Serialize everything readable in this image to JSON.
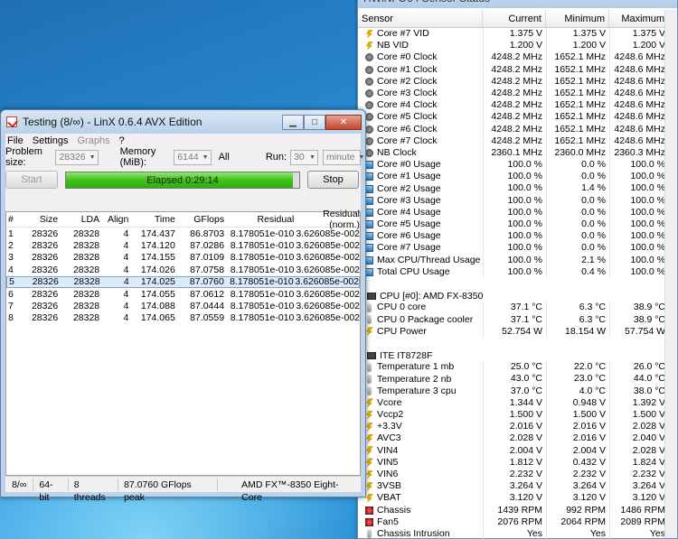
{
  "hwinfo": {
    "title": "HWiNFO64 Sensor Status",
    "columns": [
      "Sensor",
      "Current",
      "Minimum",
      "Maximum"
    ],
    "groups": [
      {
        "header": "",
        "rows": [
          {
            "icon": "volt",
            "name": "Core #7 VID",
            "cur": "1.375 V",
            "min": "1.375 V",
            "max": "1.375 V"
          },
          {
            "icon": "volt",
            "name": "NB VID",
            "cur": "1.200 V",
            "min": "1.200 V",
            "max": "1.200 V"
          },
          {
            "icon": "clock",
            "name": "Core #0 Clock",
            "cur": "4248.2 MHz",
            "min": "1652.1 MHz",
            "max": "4248.6 MHz"
          },
          {
            "icon": "clock",
            "name": "Core #1 Clock",
            "cur": "4248.2 MHz",
            "min": "1652.1 MHz",
            "max": "4248.6 MHz"
          },
          {
            "icon": "clock",
            "name": "Core #2 Clock",
            "cur": "4248.2 MHz",
            "min": "1652.1 MHz",
            "max": "4248.6 MHz"
          },
          {
            "icon": "clock",
            "name": "Core #3 Clock",
            "cur": "4248.2 MHz",
            "min": "1652.1 MHz",
            "max": "4248.6 MHz"
          },
          {
            "icon": "clock",
            "name": "Core #4 Clock",
            "cur": "4248.2 MHz",
            "min": "1652.1 MHz",
            "max": "4248.6 MHz"
          },
          {
            "icon": "clock",
            "name": "Core #5 Clock",
            "cur": "4248.2 MHz",
            "min": "1652.1 MHz",
            "max": "4248.6 MHz"
          },
          {
            "icon": "clock",
            "name": "Core #6 Clock",
            "cur": "4248.2 MHz",
            "min": "1652.1 MHz",
            "max": "4248.6 MHz"
          },
          {
            "icon": "clock",
            "name": "Core #7 Clock",
            "cur": "4248.2 MHz",
            "min": "1652.1 MHz",
            "max": "4248.6 MHz"
          },
          {
            "icon": "clock",
            "name": "NB Clock",
            "cur": "2360.1 MHz",
            "min": "2360.0 MHz",
            "max": "2360.3 MHz"
          },
          {
            "icon": "usage",
            "name": "Core #0 Usage",
            "cur": "100.0 %",
            "min": "0.0 %",
            "max": "100.0 %"
          },
          {
            "icon": "usage",
            "name": "Core #1 Usage",
            "cur": "100.0 %",
            "min": "0.0 %",
            "max": "100.0 %"
          },
          {
            "icon": "usage",
            "name": "Core #2 Usage",
            "cur": "100.0 %",
            "min": "1.4 %",
            "max": "100.0 %"
          },
          {
            "icon": "usage",
            "name": "Core #3 Usage",
            "cur": "100.0 %",
            "min": "0.0 %",
            "max": "100.0 %"
          },
          {
            "icon": "usage",
            "name": "Core #4 Usage",
            "cur": "100.0 %",
            "min": "0.0 %",
            "max": "100.0 %"
          },
          {
            "icon": "usage",
            "name": "Core #5 Usage",
            "cur": "100.0 %",
            "min": "0.0 %",
            "max": "100.0 %"
          },
          {
            "icon": "usage",
            "name": "Core #6 Usage",
            "cur": "100.0 %",
            "min": "0.0 %",
            "max": "100.0 %"
          },
          {
            "icon": "usage",
            "name": "Core #7 Usage",
            "cur": "100.0 %",
            "min": "0.0 %",
            "max": "100.0 %"
          },
          {
            "icon": "usage",
            "name": "Max CPU/Thread Usage",
            "cur": "100.0 %",
            "min": "2.1 %",
            "max": "100.0 %"
          },
          {
            "icon": "usage",
            "name": "Total CPU Usage",
            "cur": "100.0 %",
            "min": "0.4 %",
            "max": "100.0 %"
          }
        ]
      },
      {
        "header": "CPU [#0]: AMD FX-8350",
        "rows": [
          {
            "icon": "temp",
            "name": "CPU 0 core",
            "cur": "37.1 °C",
            "min": "6.3 °C",
            "max": "38.9 °C"
          },
          {
            "icon": "temp",
            "name": "CPU 0 Package cooler",
            "cur": "37.1 °C",
            "min": "6.3 °C",
            "max": "38.9 °C"
          },
          {
            "icon": "power",
            "name": "CPU Power",
            "cur": "52.754 W",
            "min": "18.154 W",
            "max": "57.754 W"
          }
        ]
      },
      {
        "header": "ITE IT8728F",
        "rows": [
          {
            "icon": "temp",
            "name": "Temperature 1 mb",
            "cur": "25.0 °C",
            "min": "22.0 °C",
            "max": "26.0 °C"
          },
          {
            "icon": "temp",
            "name": "Temperature 2 nb",
            "cur": "43.0 °C",
            "min": "23.0 °C",
            "max": "44.0 °C"
          },
          {
            "icon": "temp",
            "name": "Temperature 3 cpu",
            "cur": "37.0 °C",
            "min": "4.0 °C",
            "max": "38.0 °C"
          },
          {
            "icon": "volt",
            "name": "Vcore",
            "cur": "1.344 V",
            "min": "0.948 V",
            "max": "1.392 V"
          },
          {
            "icon": "volt",
            "name": "Vccp2",
            "cur": "1.500 V",
            "min": "1.500 V",
            "max": "1.500 V"
          },
          {
            "icon": "volt",
            "name": "+3.3V",
            "cur": "2.016 V",
            "min": "2.016 V",
            "max": "2.028 V"
          },
          {
            "icon": "volt",
            "name": "AVC3",
            "cur": "2.028 V",
            "min": "2.016 V",
            "max": "2.040 V"
          },
          {
            "icon": "volt",
            "name": "VIN4",
            "cur": "2.004 V",
            "min": "2.004 V",
            "max": "2.028 V"
          },
          {
            "icon": "volt",
            "name": "VIN5",
            "cur": "1.812 V",
            "min": "0.432 V",
            "max": "1.824 V"
          },
          {
            "icon": "volt",
            "name": "VIN6",
            "cur": "2.232 V",
            "min": "2.232 V",
            "max": "2.232 V"
          },
          {
            "icon": "volt",
            "name": "3VSB",
            "cur": "3.264 V",
            "min": "3.264 V",
            "max": "3.264 V"
          },
          {
            "icon": "volt",
            "name": "VBAT",
            "cur": "3.120 V",
            "min": "3.120 V",
            "max": "3.120 V"
          },
          {
            "icon": "fan",
            "name": "Chassis",
            "cur": "1439 RPM",
            "min": "992 RPM",
            "max": "1486 RPM"
          },
          {
            "icon": "fan",
            "name": "Fan5",
            "cur": "2076 RPM",
            "min": "2064 RPM",
            "max": "2089 RPM"
          },
          {
            "icon": "temp",
            "name": "Chassis Intrusion",
            "cur": "Yes",
            "min": "Yes",
            "max": "Yes"
          }
        ]
      }
    ]
  },
  "linx": {
    "title": "Testing (8/∞) - LinX 0.6.4 AVX Edition",
    "menu": [
      {
        "label": "File",
        "enabled": true
      },
      {
        "label": "Settings",
        "enabled": true
      },
      {
        "label": "Graphs",
        "enabled": false
      },
      {
        "label": "?",
        "enabled": true
      }
    ],
    "problem_size_label": "Problem size:",
    "problem_size_value": "28326",
    "memory_label": "Memory (MiB):",
    "memory_value": "6144",
    "all_label": "All",
    "run_label": "Run:",
    "run_value": "30",
    "run_unit": "minute",
    "start_label": "Start",
    "stop_label": "Stop",
    "progress_text": "Elapsed 0:29:14",
    "progress_fraction": 0.974,
    "table_headers": [
      "#",
      "Size",
      "LDA",
      "Align",
      "Time",
      "GFlops",
      "Residual",
      "Residual (norm.)"
    ],
    "selected_row": 4,
    "rows": [
      [
        "1",
        "28326",
        "28328",
        "4",
        "174.437",
        "86.8703",
        "8.178051e-010",
        "3.626085e-002"
      ],
      [
        "2",
        "28326",
        "28328",
        "4",
        "174.120",
        "87.0286",
        "8.178051e-010",
        "3.626085e-002"
      ],
      [
        "3",
        "28326",
        "28328",
        "4",
        "174.155",
        "87.0109",
        "8.178051e-010",
        "3.626085e-002"
      ],
      [
        "4",
        "28326",
        "28328",
        "4",
        "174.026",
        "87.0758",
        "8.178051e-010",
        "3.626085e-002"
      ],
      [
        "5",
        "28326",
        "28328",
        "4",
        "174.025",
        "87.0760",
        "8.178051e-010",
        "3.626085e-002"
      ],
      [
        "6",
        "28326",
        "28328",
        "4",
        "174.055",
        "87.0612",
        "8.178051e-010",
        "3.626085e-002"
      ],
      [
        "7",
        "28326",
        "28328",
        "4",
        "174.088",
        "87.0444",
        "8.178051e-010",
        "3.626085e-002"
      ],
      [
        "8",
        "28326",
        "28328",
        "4",
        "174.065",
        "87.0559",
        "8.178051e-010",
        "3.626085e-002"
      ]
    ],
    "status": {
      "progress": "8/∞",
      "bitness": "64-bit",
      "threads": "8 threads",
      "peak": "87.0760 GFlops peak",
      "cpu": "AMD FX™-8350 Eight-Core"
    }
  }
}
